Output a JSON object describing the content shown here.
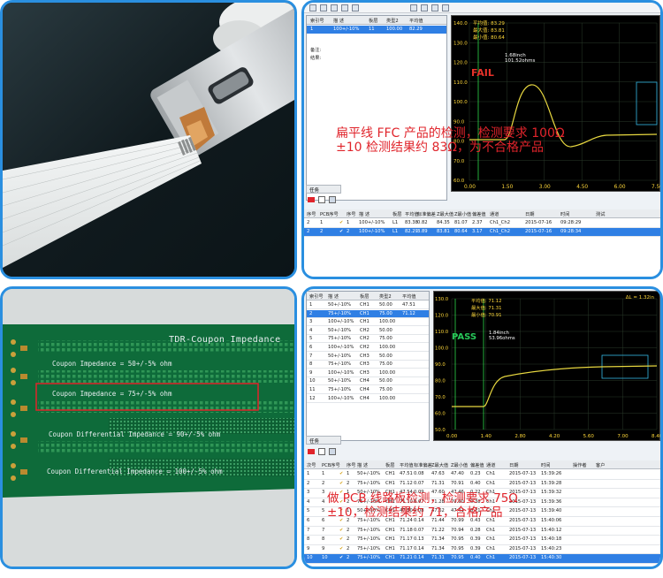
{
  "panel_tr": {
    "grid_headers": [
      "索引号",
      "描 述",
      "板层",
      "类型2",
      "平均值"
    ],
    "row": [
      "1",
      "100+/-10%",
      "11",
      "100.00",
      "82.29"
    ],
    "side_labels": [
      "备注:",
      "结果:"
    ],
    "readout_lines": [
      "平均值:  83.29",
      "最大值:  83.81",
      "最小值:  80.64"
    ],
    "yticks": [
      "140.0",
      "130.0",
      "120.0",
      "110.0",
      "100.0",
      "90.0",
      "80.0",
      "70.0",
      "60.0"
    ],
    "xticks": [
      "0.00",
      "1.50",
      "3.00",
      "4.50",
      "6.00",
      "7.50"
    ],
    "status": "FAIL",
    "cursor_lines": [
      "1.68inch",
      "101.52ohms"
    ],
    "caption_lines": [
      "扁平线 FFC 产品的检测，检测要求 100Ω",
      "±10 检测结果约 83Ω，为不合格产品"
    ],
    "tab_label": "任务",
    "table_headers": [
      "序号",
      "PCB序号",
      "序号",
      "描 述",
      "板层",
      "平均值",
      "标准偏差",
      "Z最大值",
      "Z最小值",
      "偏差值",
      "通道",
      "日期",
      "时间",
      "测试"
    ],
    "table_rows": [
      [
        "2",
        "1",
        "1",
        "100+/-10%",
        "L1",
        "83.38",
        "0.82",
        "84.35",
        "81.07",
        "2.37",
        "Ch1_Ch2",
        "2015-07-16",
        "09:28:29"
      ],
      [
        "2",
        "2",
        "2",
        "100+/-10%",
        "L1",
        "82.29",
        "3.89",
        "83.81",
        "80.64",
        "3.17",
        "Ch1_Ch2",
        "2015-07-16",
        "09:28:34"
      ]
    ]
  },
  "panel_bl": {
    "title": "TDR-Coupon Impedance",
    "lines": [
      "Coupon Impedance = 50+/-5% ohm",
      "Coupon Impedance = 75+/-5% ohm",
      "Coupon Differential Impedance = 90+/-5% ohm",
      "Coupon Differential Impedance = 100+/-5% ohm"
    ]
  },
  "panel_br": {
    "grid_headers": [
      "索引号",
      "描 述",
      "板层",
      "类型2",
      "平均值"
    ],
    "rows": [
      [
        "1",
        "50+/-10%",
        "CH1",
        "50.00",
        "47.51"
      ],
      [
        "2",
        "75+/-10%",
        "CH1",
        "75.00",
        "71.12"
      ],
      [
        "3",
        "100+/-10%",
        "CH1",
        "100.00",
        ""
      ],
      [
        "4",
        "50+/-10%",
        "CH2",
        "50.00",
        ""
      ],
      [
        "5",
        "75+/-10%",
        "CH2",
        "75.00",
        ""
      ],
      [
        "6",
        "100+/-10%",
        "CH2",
        "100.00",
        ""
      ],
      [
        "7",
        "50+/-10%",
        "CH3",
        "50.00",
        ""
      ],
      [
        "8",
        "75+/-10%",
        "CH3",
        "75.00",
        ""
      ],
      [
        "9",
        "100+/-10%",
        "CH3",
        "100.00",
        ""
      ],
      [
        "10",
        "50+/-10%",
        "CH4",
        "50.00",
        ""
      ],
      [
        "11",
        "75+/-10%",
        "CH4",
        "75.00",
        ""
      ],
      [
        "12",
        "100+/-10%",
        "CH4",
        "100.00",
        ""
      ]
    ],
    "readout_lines": [
      "平均值:  71.12",
      "最大值:  71.31",
      "最小值:  70.91"
    ],
    "yticks": [
      "130.0",
      "120.0",
      "110.0",
      "100.0",
      "90.0",
      "80.0",
      "70.0",
      "60.0",
      "50.0"
    ],
    "xticks": [
      "0.00",
      "1.40",
      "2.80",
      "4.20",
      "5.60",
      "7.00",
      "8.40"
    ],
    "status": "PASS",
    "cursor_lines": [
      "1.84inch",
      "53.96ohms"
    ],
    "delta": "ΔL = 1.32in",
    "caption_lines": [
      "做 PCB 线路板检测，检测要求 75Ω",
      "±10，检测结果约 71，合格产品"
    ],
    "tab_label": "任务",
    "table_headers": [
      "次号",
      "PCB序号",
      "序号",
      "描 述",
      "板层",
      "平均值",
      "标准偏差",
      "Z最大值",
      "Z最小值",
      "偏差值",
      "通道",
      "日期",
      "时间",
      "操作者",
      "客户"
    ],
    "table_rows": [
      [
        "1",
        "1",
        "1",
        "50+/-10%",
        "CH1",
        "47.51",
        "0.08",
        "47.63",
        "47.40",
        "0.23",
        "Ch1",
        "2015-07-13",
        "15:39:26"
      ],
      [
        "2",
        "2",
        "2",
        "75+/-10%",
        "CH1",
        "71.12",
        "0.07",
        "71.31",
        "70.91",
        "0.40",
        "Ch1",
        "2015-07-13",
        "15:39:28"
      ],
      [
        "3",
        "3",
        "1",
        "50+/-10%",
        "CH1",
        "47.54",
        "0.09",
        "47.60",
        "47.46",
        "0.22",
        "Ch1",
        "2015-07-13",
        "15:39:32"
      ],
      [
        "4",
        "4",
        "2",
        "75+/-10%",
        "CH1",
        "71.10",
        "0.07",
        "71.28",
        "70.90",
        "0.38",
        "Ch1",
        "2015-07-13",
        "15:39:36"
      ],
      [
        "5",
        "5",
        "1",
        "50+/-10%",
        "CH1",
        "47.50",
        "0.08",
        "47.62",
        "47.41",
        "0.21",
        "Ch1",
        "2015-07-13",
        "15:39:40"
      ],
      [
        "6",
        "6",
        "2",
        "75+/-10%",
        "CH1",
        "71.24",
        "0.14",
        "71.44",
        "70.99",
        "0.43",
        "Ch1",
        "2015-07-13",
        "15:40:06"
      ],
      [
        "7",
        "7",
        "2",
        "75+/-10%",
        "CH1",
        "71.18",
        "0.07",
        "71.22",
        "70.94",
        "0.28",
        "Ch1",
        "2015-07-13",
        "15:40:12"
      ],
      [
        "8",
        "8",
        "2",
        "75+/-10%",
        "CH1",
        "71.17",
        "0.13",
        "71.34",
        "70.95",
        "0.39",
        "Ch1",
        "2015-07-13",
        "15:40:18"
      ],
      [
        "9",
        "9",
        "2",
        "75+/-10%",
        "CH1",
        "71.17",
        "0.14",
        "71.34",
        "70.95",
        "0.39",
        "Ch1",
        "2015-07-13",
        "15:40:23"
      ],
      [
        "10",
        "10",
        "2",
        "75+/-10%",
        "CH1",
        "71.21",
        "0.14",
        "71.31",
        "70.95",
        "0.40",
        "Ch1",
        "2015-07-13",
        "15:40:30"
      ]
    ]
  },
  "colors": {
    "frame": "#2a8fe0",
    "caption_red": "#e0242b",
    "status_red": "#e8322a",
    "status_green": "#28c95a",
    "trace": "#e8d840",
    "pcb_green": "#0e6b3a"
  }
}
